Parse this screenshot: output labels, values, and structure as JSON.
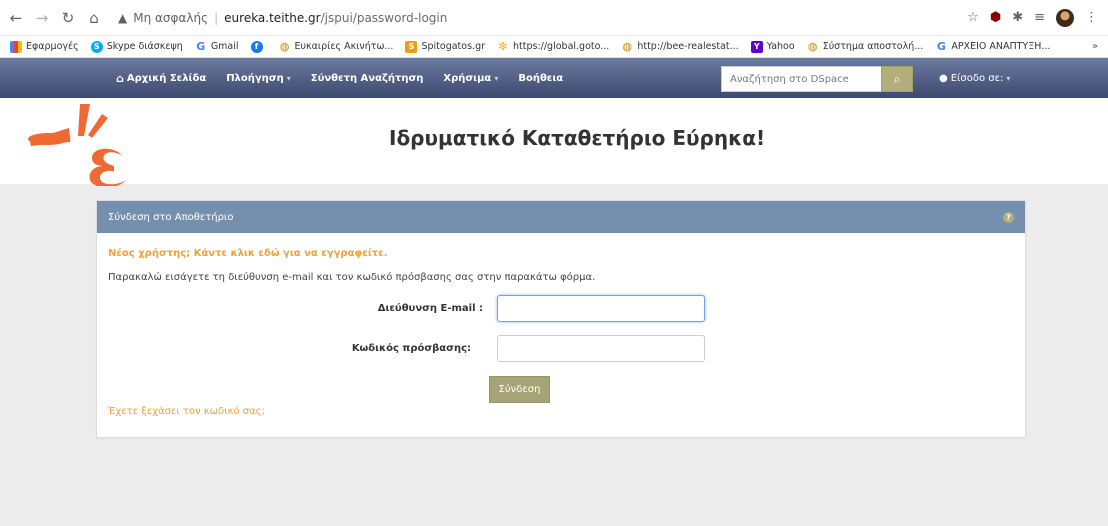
{
  "browser": {
    "security_label": "Μη ασφαλής",
    "url_host": "eureka.teithe.gr",
    "url_path": "/jspui/password-login"
  },
  "bookmarks": [
    {
      "label": "Εφαρμογές",
      "icon": "apps-icon"
    },
    {
      "label": "Skype διάσκεψη",
      "icon": "skype-icon"
    },
    {
      "label": "Gmail",
      "icon": "google-icon"
    },
    {
      "label": "",
      "icon": "facebook-icon"
    },
    {
      "label": "Ευκαιρίες Ακινήτω...",
      "icon": "globe-icon"
    },
    {
      "label": "Spitogatos.gr",
      "icon": "spitogatos-icon"
    },
    {
      "label": "https://global.goto...",
      "icon": "star-icon"
    },
    {
      "label": "http://bee-realestat...",
      "icon": "globe-icon"
    },
    {
      "label": "Yahoo",
      "icon": "yahoo-icon"
    },
    {
      "label": "Σύστημα αποστολή...",
      "icon": "globe-icon"
    },
    {
      "label": "ΑΡΧΕΙΟ ΑΝΑΠΤΥΞΗ...",
      "icon": "google-icon"
    }
  ],
  "bookmarks_more": "»",
  "nav": {
    "home": "Αρχική Σελίδα",
    "browse": "Πλοήγηση",
    "advanced": "Σύνθετη Αναζήτηση",
    "tools": "Χρήσιμα",
    "help": "Βοήθεια",
    "search_placeholder": "Αναζήτηση στο DSpace",
    "login": "Είσοδο σε:"
  },
  "site_title": "Ιδρυματικό Καταθετήριο Εύρηκα!",
  "login_card": {
    "title": "Σύνδεση στο Αποθετήριο",
    "new_user": "Νέος χρήστης; Κάντε κλικ εδώ για να εγγραφείτε.",
    "instructions": "Παρακαλώ εισάγετε τη διεύθυνση e-mail και τον κωδικό πρόσβασης σας στην παρακάτω φόρμα.",
    "email_label": "Διεύθυνση E-mail :",
    "password_label": "Κωδικός πρόσβασης:",
    "email_value": "",
    "password_value": "",
    "submit_label": "Σύνδεση",
    "forgot": "Έχετε ξεχάσει τον κωδικό σας;"
  },
  "colors": {
    "nav_top": "#6c7aa0",
    "nav_bottom": "#3c4a70",
    "card_header": "#7590ae",
    "accent_orange": "#f0a03c",
    "button_olive": "#a5a477",
    "logo_orange": "#ee6a32"
  }
}
